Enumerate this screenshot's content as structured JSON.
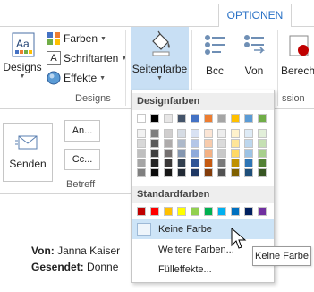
{
  "tabs": {
    "active": "OPTIONEN"
  },
  "ribbon": {
    "designs_label": "Designs",
    "farben_label": "Farben",
    "schriftarten_label": "Schriftarten",
    "effekte_label": "Effekte",
    "seitenfarbe_label": "Seitenfarbe",
    "bcc_label": "Bcc",
    "von_label": "Von",
    "berech_label": "Berech",
    "group_designs": "Designs",
    "group_partial": "ssion"
  },
  "compose": {
    "send_label": "Senden",
    "an_label": "An...",
    "cc_label": "Cc...",
    "betreff_group": "Betreff",
    "von_key": "Von:",
    "von_value": "Janna Kaiser",
    "gesendet_key": "Gesendet:",
    "gesendet_value": "Donne"
  },
  "dropdown": {
    "designfarben_header": "Designfarben",
    "standardfarben_header": "Standardfarben",
    "keine_farbe": "Keine Farbe",
    "weitere_farben": "Weitere Farben...",
    "fuelleffekte": "Fülleffekte...",
    "design_top_row": [
      "#ffffff",
      "#000000",
      "#e7e6e6",
      "#44546a",
      "#4472c4",
      "#ed7d31",
      "#a5a5a5",
      "#ffc000",
      "#5b9bd5",
      "#70ad47"
    ],
    "design_shades": [
      [
        "#f2f2f2",
        "#7f7f7f",
        "#d0cece",
        "#d6dce4",
        "#d9e2f3",
        "#fbe5d5",
        "#ededed",
        "#fff2cc",
        "#deebf6",
        "#e2efd9"
      ],
      [
        "#d8d8d8",
        "#595959",
        "#aeabab",
        "#adb9ca",
        "#b4c6e7",
        "#f7cbac",
        "#dbdbdb",
        "#fee599",
        "#bdd7ee",
        "#c5e0b3"
      ],
      [
        "#bfbfbf",
        "#3f3f3f",
        "#757070",
        "#8496b0",
        "#8eaadb",
        "#f4b183",
        "#c9c9c9",
        "#ffd965",
        "#9cc3e5",
        "#a8d08d"
      ],
      [
        "#a5a5a5",
        "#262626",
        "#3a3838",
        "#323f4f",
        "#2f5496",
        "#c55a11",
        "#7b7b7b",
        "#bf9000",
        "#2e75b5",
        "#538135"
      ],
      [
        "#7f7f7f",
        "#0c0c0c",
        "#171616",
        "#222a35",
        "#1f3864",
        "#833c0b",
        "#525252",
        "#7f6000",
        "#1e4e79",
        "#375623"
      ]
    ],
    "standard_row": [
      "#c00000",
      "#ff0000",
      "#ffc000",
      "#ffff00",
      "#92d050",
      "#00b050",
      "#00b0f0",
      "#0070c0",
      "#002060",
      "#7030a0"
    ]
  },
  "tooltip": {
    "text": "Keine Farbe"
  }
}
